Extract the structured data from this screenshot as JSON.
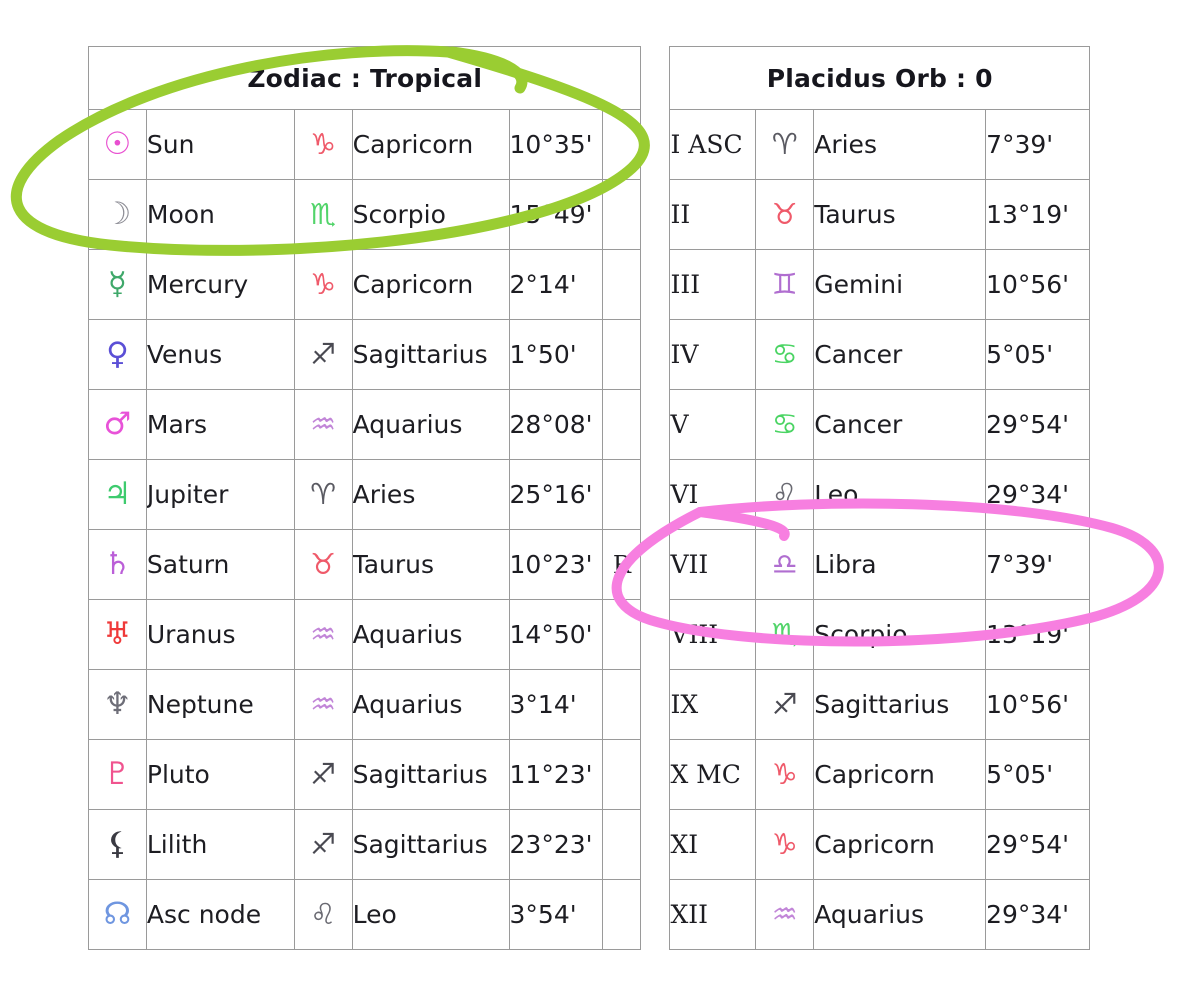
{
  "left_table": {
    "title": "Zodiac : Tropical",
    "rows": [
      {
        "symbol": "☉",
        "symbol_name": "sun-symbol",
        "symbol_color": "#e84fd0",
        "body": "Sun",
        "sign_symbol": "♑",
        "sign_symbol_name": "capricorn-symbol",
        "sign_color": "#ef5a6a",
        "sign": "Capricorn",
        "degree": "10°35'",
        "retrograde": ""
      },
      {
        "symbol": "☽",
        "symbol_name": "moon-symbol",
        "symbol_color": "#8e8e96",
        "body": "Moon",
        "sign_symbol": "♏",
        "sign_symbol_name": "scorpio-symbol",
        "sign_color": "#52d46a",
        "sign": "Scorpio",
        "degree": "15°49'",
        "retrograde": ""
      },
      {
        "symbol": "☿",
        "symbol_name": "mercury-symbol",
        "symbol_color": "#3fa86a",
        "body": "Mercury",
        "sign_symbol": "♑",
        "sign_symbol_name": "capricorn-symbol",
        "sign_color": "#ef5a6a",
        "sign": "Capricorn",
        "degree": "2°14'",
        "retrograde": ""
      },
      {
        "symbol": "♀",
        "symbol_name": "venus-symbol",
        "symbol_color": "#5b4fd6",
        "body": "Venus",
        "sign_symbol": "♐",
        "sign_symbol_name": "sagittarius-symbol",
        "sign_color": "#4a4a52",
        "sign": "Sagittarius",
        "degree": "1°50'",
        "retrograde": ""
      },
      {
        "symbol": "♂",
        "symbol_name": "mars-symbol",
        "symbol_color": "#e852d8",
        "body": "Mars",
        "sign_symbol": "♒",
        "sign_symbol_name": "aquarius-symbol",
        "sign_color": "#c286d8",
        "sign": "Aquarius",
        "degree": "28°08'",
        "retrograde": ""
      },
      {
        "symbol": "♃",
        "symbol_name": "jupiter-symbol",
        "symbol_color": "#3ecb6e",
        "body": "Jupiter",
        "sign_symbol": "♈",
        "sign_symbol_name": "aries-symbol",
        "sign_color": "#5a5a62",
        "sign": "Aries",
        "degree": "25°16'",
        "retrograde": ""
      },
      {
        "symbol": "♄",
        "symbol_name": "saturn-symbol",
        "symbol_color": "#bb5fd8",
        "body": "Saturn",
        "sign_symbol": "♉",
        "sign_symbol_name": "taurus-symbol",
        "sign_color": "#ef5a6a",
        "sign": "Taurus",
        "degree": "10°23'",
        "retrograde": "R"
      },
      {
        "symbol": "♅",
        "symbol_name": "uranus-symbol",
        "symbol_color": "#ef3a3a",
        "body": "Uranus",
        "sign_symbol": "♒",
        "sign_symbol_name": "aquarius-symbol",
        "sign_color": "#c286d8",
        "sign": "Aquarius",
        "degree": "14°50'",
        "retrograde": ""
      },
      {
        "symbol": "♆",
        "symbol_name": "neptune-symbol",
        "symbol_color": "#6e6e78",
        "body": "Neptune",
        "sign_symbol": "♒",
        "sign_symbol_name": "aquarius-symbol",
        "sign_color": "#c286d8",
        "sign": "Aquarius",
        "degree": "3°14'",
        "retrograde": ""
      },
      {
        "symbol": "♇",
        "symbol_name": "pluto-symbol",
        "symbol_color": "#f0548f",
        "body": "Pluto",
        "sign_symbol": "♐",
        "sign_symbol_name": "sagittarius-symbol",
        "sign_color": "#4a4a52",
        "sign": "Sagittarius",
        "degree": "11°23'",
        "retrograde": ""
      },
      {
        "symbol": "⚸",
        "symbol_name": "lilith-symbol",
        "symbol_color": "#3a3a42",
        "body": "Lilith",
        "sign_symbol": "♐",
        "sign_symbol_name": "sagittarius-symbol",
        "sign_color": "#4a4a52",
        "sign": "Sagittarius",
        "degree": "23°23'",
        "retrograde": ""
      },
      {
        "symbol": "☊",
        "symbol_name": "ascending-node-symbol",
        "symbol_color": "#6f96e0",
        "body": "Asc node",
        "sign_symbol": "♌",
        "sign_symbol_name": "leo-symbol",
        "sign_color": "#6a6a72",
        "sign": "Leo",
        "degree": "3°54'",
        "retrograde": ""
      }
    ]
  },
  "right_table": {
    "title": "Placidus Orb : 0",
    "rows": [
      {
        "house": "I ASC",
        "sign_symbol": "♈",
        "sign_symbol_name": "aries-symbol",
        "sign_color": "#5a5a62",
        "sign": "Aries",
        "degree": "7°39'"
      },
      {
        "house": "II",
        "sign_symbol": "♉",
        "sign_symbol_name": "taurus-symbol",
        "sign_color": "#ef5a6a",
        "sign": "Taurus",
        "degree": "13°19'"
      },
      {
        "house": "III",
        "sign_symbol": "♊",
        "sign_symbol_name": "gemini-symbol",
        "sign_color": "#b06ed0",
        "sign": "Gemini",
        "degree": "10°56'"
      },
      {
        "house": "IV",
        "sign_symbol": "♋",
        "sign_symbol_name": "cancer-symbol",
        "sign_color": "#4ad463",
        "sign": "Cancer",
        "degree": "5°05'"
      },
      {
        "house": "V",
        "sign_symbol": "♋",
        "sign_symbol_name": "cancer-symbol",
        "sign_color": "#4ad463",
        "sign": "Cancer",
        "degree": "29°54'"
      },
      {
        "house": "VI",
        "sign_symbol": "♌",
        "sign_symbol_name": "leo-symbol",
        "sign_color": "#6a6a72",
        "sign": "Leo",
        "degree": "29°34'"
      },
      {
        "house": "VII",
        "sign_symbol": "♎",
        "sign_symbol_name": "libra-symbol",
        "sign_color": "#b06ed0",
        "sign": "Libra",
        "degree": "7°39'"
      },
      {
        "house": "VIII",
        "sign_symbol": "♏",
        "sign_symbol_name": "scorpio-symbol",
        "sign_color": "#52d46a",
        "sign": "Scorpio",
        "degree": "13°19'"
      },
      {
        "house": "IX",
        "sign_symbol": "♐",
        "sign_symbol_name": "sagittarius-symbol",
        "sign_color": "#4a4a52",
        "sign": "Sagittarius",
        "degree": "10°56'"
      },
      {
        "house": "X MC",
        "sign_symbol": "♑",
        "sign_symbol_name": "capricorn-symbol",
        "sign_color": "#ef5a6a",
        "sign": "Capricorn",
        "degree": "5°05'"
      },
      {
        "house": "XI",
        "sign_symbol": "♑",
        "sign_symbol_name": "capricorn-symbol",
        "sign_color": "#ef5a6a",
        "sign": "Capricorn",
        "degree": "29°54'"
      },
      {
        "house": "XII",
        "sign_symbol": "♒",
        "sign_symbol_name": "aquarius-symbol",
        "sign_color": "#c286d8",
        "sign": "Aquarius",
        "degree": "29°34'"
      }
    ]
  },
  "annotations": [
    {
      "name": "green-highlight-ellipse",
      "color": "#9acd32",
      "targets": "Zodiac : Tropical header and Sun row"
    },
    {
      "name": "pink-highlight-ellipse",
      "color": "#f77fe0",
      "targets": "House VII Libra 7°39' row"
    }
  ]
}
